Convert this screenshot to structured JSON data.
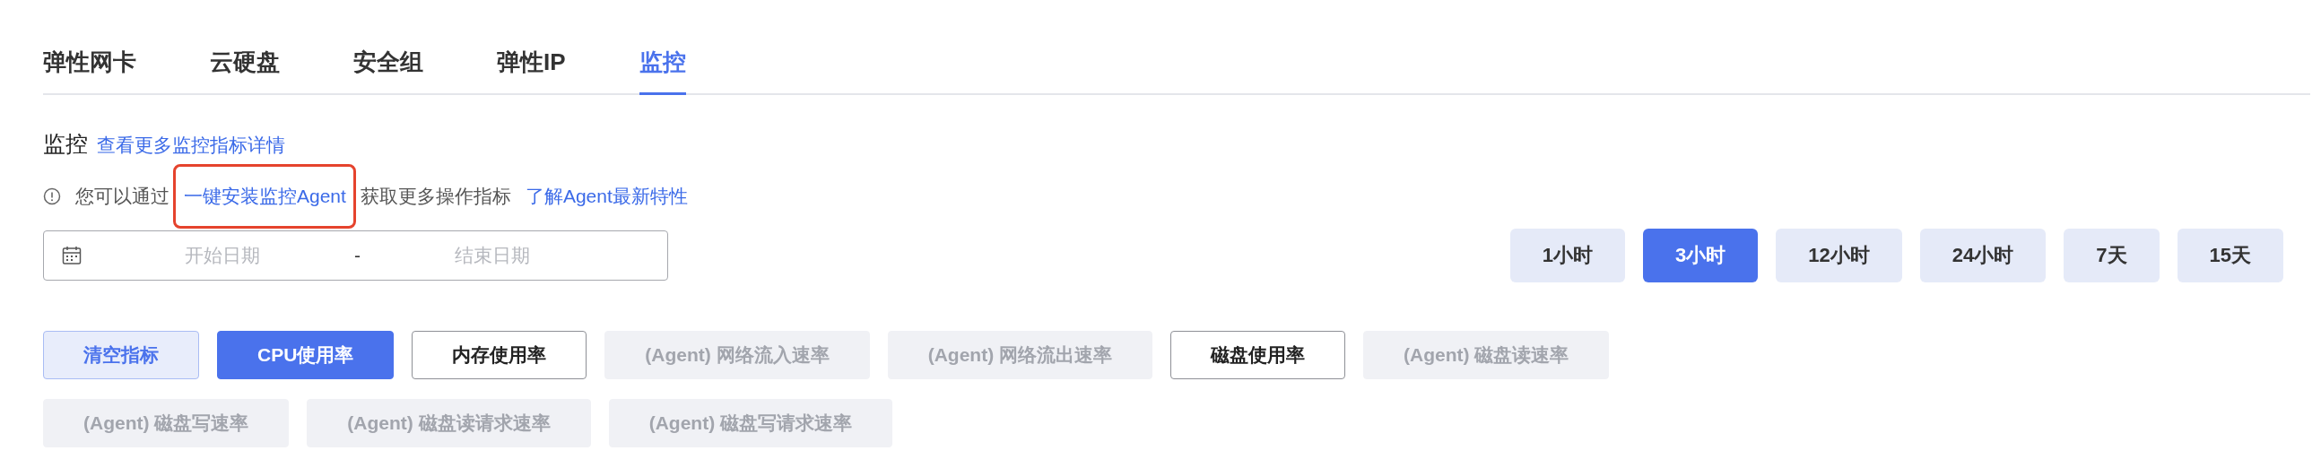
{
  "tabs": [
    {
      "label": "弹性网卡",
      "selected": false
    },
    {
      "label": "云硬盘",
      "selected": false
    },
    {
      "label": "安全组",
      "selected": false
    },
    {
      "label": "弹性IP",
      "selected": false
    },
    {
      "label": "监控",
      "selected": true
    }
  ],
  "section": {
    "title": "监控",
    "link": "查看更多监控指标详情"
  },
  "notice": [
    {
      "kind": "text",
      "text": "您可以通过"
    },
    {
      "kind": "link",
      "text": "一键安装监控Agent",
      "highlighted": true
    },
    {
      "kind": "text",
      "text": "获取更多操作指标"
    },
    {
      "kind": "link",
      "text": "了解Agent最新特性"
    }
  ],
  "date_range": {
    "start_placeholder": "开始日期",
    "separator": "-",
    "end_placeholder": "结束日期"
  },
  "time_ranges": [
    {
      "label": "1小时",
      "selected": false
    },
    {
      "label": "3小时",
      "selected": true
    },
    {
      "label": "12小时",
      "selected": false
    },
    {
      "label": "24小时",
      "selected": false
    },
    {
      "label": "7天",
      "selected": false
    },
    {
      "label": "15天",
      "selected": false
    }
  ],
  "clear_button": "清空指标",
  "metrics": [
    {
      "label": "CPU使用率",
      "selected": true,
      "disabled": false
    },
    {
      "label": "内存使用率",
      "selected": false,
      "disabled": false
    },
    {
      "label": "(Agent) 网络流入速率",
      "selected": false,
      "disabled": true
    },
    {
      "label": "(Agent) 网络流出速率",
      "selected": false,
      "disabled": true
    },
    {
      "label": "磁盘使用率",
      "selected": false,
      "disabled": false
    },
    {
      "label": "(Agent) 磁盘读速率",
      "selected": false,
      "disabled": true
    },
    {
      "label": "(Agent) 磁盘写速率",
      "selected": false,
      "disabled": true
    },
    {
      "label": "(Agent) 磁盘读请求速率",
      "selected": false,
      "disabled": true
    },
    {
      "label": "(Agent) 磁盘写请求速率",
      "selected": false,
      "disabled": true
    }
  ]
}
